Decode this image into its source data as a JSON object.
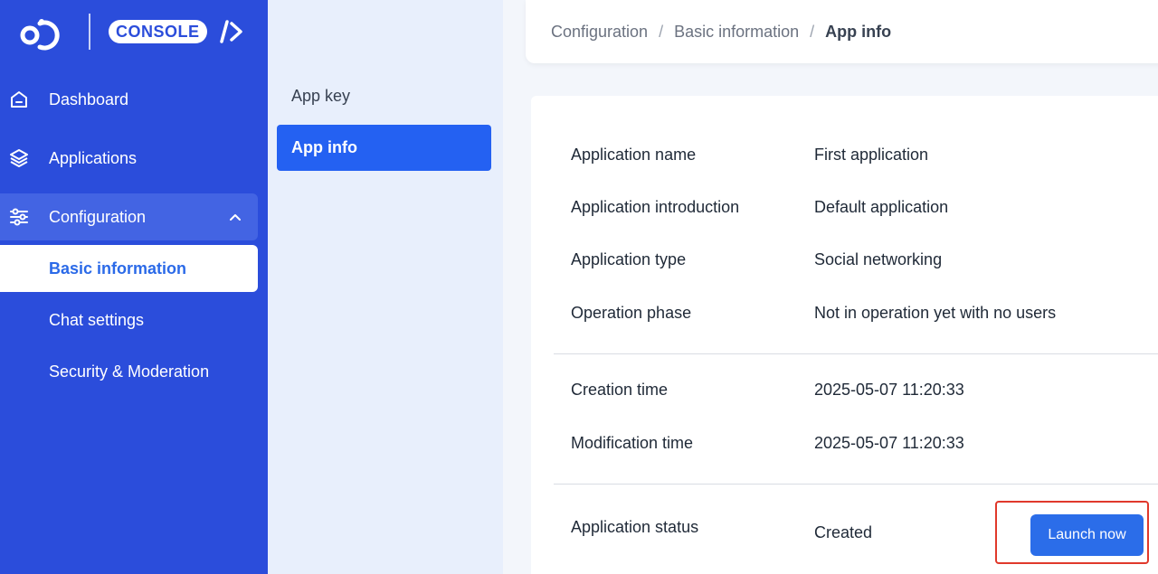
{
  "brand": {
    "console_label": "CONSOLE"
  },
  "sidebar": {
    "items": [
      {
        "label": "Dashboard",
        "icon": "home-icon"
      },
      {
        "label": "Applications",
        "icon": "layers-icon"
      },
      {
        "label": "Configuration",
        "icon": "sliders-icon"
      }
    ],
    "sub_items": [
      {
        "label": "Basic information"
      },
      {
        "label": "Chat settings"
      },
      {
        "label": "Security & Moderation"
      }
    ]
  },
  "submenu": {
    "items": [
      {
        "label": "App key"
      },
      {
        "label": "App info"
      }
    ]
  },
  "breadcrumb": {
    "items": [
      "Configuration",
      "Basic information",
      "App info"
    ],
    "separator": "/"
  },
  "details": {
    "name": {
      "label": "Application name",
      "value": "First application"
    },
    "intro": {
      "label": "Application introduction",
      "value": "Default application"
    },
    "type": {
      "label": "Application type",
      "value": "Social networking"
    },
    "phase": {
      "label": "Operation phase",
      "value": "Not in operation yet with no users"
    },
    "created": {
      "label": "Creation time",
      "value": "2025-05-07 11:20:33"
    },
    "modified": {
      "label": "Modification time",
      "value": "2025-05-07 11:20:33"
    },
    "status": {
      "label": "Application status",
      "value": "Created"
    },
    "launch_label": "Launch now"
  },
  "colors": {
    "sidebar_bg": "#2b4ddb",
    "accent": "#2461f2",
    "highlight_border": "#e0392b"
  }
}
